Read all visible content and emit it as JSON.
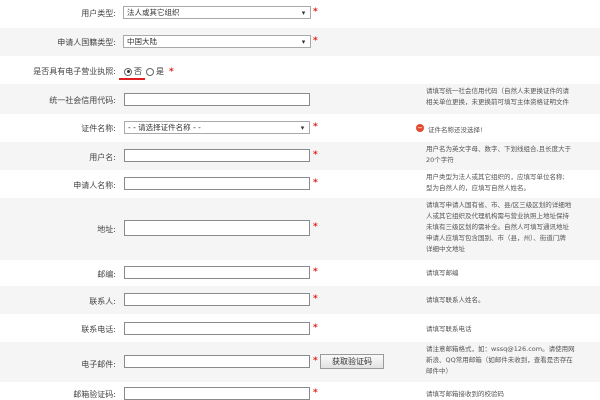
{
  "fields": {
    "user_type": {
      "label": "用户类型:",
      "value": "法人或其它组织"
    },
    "nationality": {
      "label": "申请人国籍类型:",
      "value": "中国大陆"
    },
    "ebl": {
      "label": "是否具有电子营业执照:",
      "option_no": "否",
      "option_yes": "是",
      "selected": "否"
    },
    "credit_code": {
      "label": "统一社会信用代码:",
      "value": "",
      "hint_1": "请填写统一社会信用代码（自然人未更换证件的请",
      "hint_2": "相关单位更换，未更换前可填写主体资格证明文件"
    },
    "id_type": {
      "label": "证件名称:",
      "value": "- - 请选择证件名称 - -",
      "error": "证件名称还没选择!"
    },
    "username": {
      "label": "用户名:",
      "value": "",
      "hint_1": "用户名为英文字母、数字、下划线组合,且长度大于",
      "hint_2": "20个字符"
    },
    "applicant_name": {
      "label": "申请人名称:",
      "value": "",
      "hint_1": "用户类型为法人或其它组织的，应填写单位名称;",
      "hint_2": "型为自然人的，应填写自然人姓名。"
    },
    "address": {
      "label": "地址:",
      "value": "",
      "hint_1": "请填写申请人国有省、市、县/区三级区划的详细地",
      "hint_2": "人或其它组织及代理机构需与营业执照上地址保持",
      "hint_3": "未填有三级区划的需补全。自然人可填写通讯地址",
      "hint_4": "申请人应填写包含国别、市（县，州）、街道门牌",
      "hint_5": "详细中文地址"
    },
    "postcode": {
      "label": "邮编:",
      "value": "",
      "hint_1": "请填写邮编"
    },
    "contact": {
      "label": "联系人:",
      "value": "",
      "hint_1": "请填写联系人姓名。"
    },
    "phone": {
      "label": "联系电话:",
      "value": "",
      "hint_1": "请填写联系电话"
    },
    "email": {
      "label": "电子邮件:",
      "value": "",
      "button": "获取验证码",
      "hint_1": "请注意邮箱格式，如：wssq@126.com。请使用网",
      "hint_2": "新浪、QQ常用邮箱（如邮件未收到，查看是否存在",
      "hint_3": "邮件中）"
    },
    "email_code": {
      "label": "邮箱验证码:",
      "value": "",
      "hint_1": "请填写邮箱接收到的校验码"
    }
  },
  "colors": {
    "required": "#e02020",
    "row_alt": "#f5f5f5",
    "error_icon": "#e04a2f"
  },
  "icons": {
    "dropdown": "chevron-down-icon",
    "error": "minus-circle-icon"
  }
}
